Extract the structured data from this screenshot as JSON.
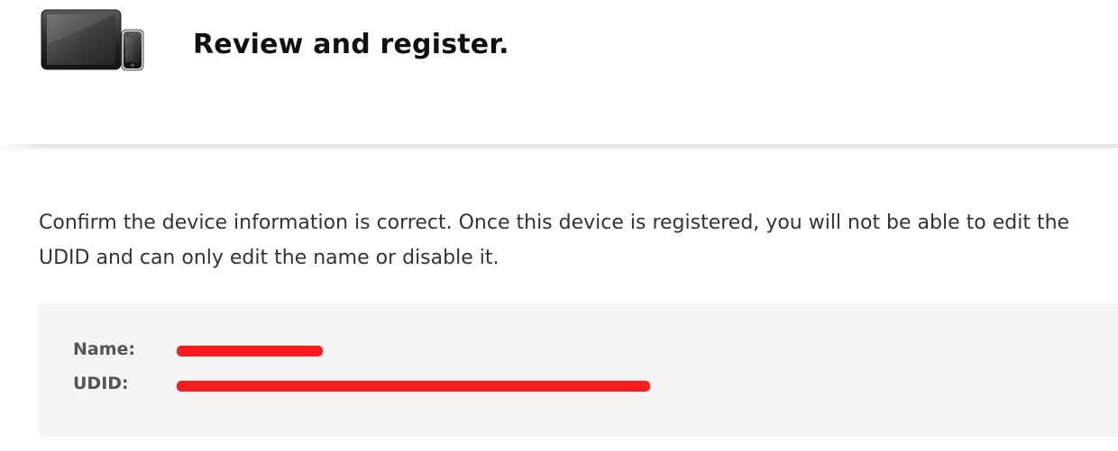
{
  "header": {
    "icon": "ipad-iphone-icon",
    "title": "Review and register."
  },
  "info": {
    "text": "Confirm the device information is correct. Once this device is registered, you will not be able to edit the UDID and can only edit the name or disable it."
  },
  "details": {
    "name_label": "Name:",
    "udid_label": "UDID:",
    "redaction_color": "#ff1b1b"
  },
  "colors": {
    "panel_background": "#f5f5f5",
    "title_text": "#111111",
    "body_text": "#333333"
  }
}
